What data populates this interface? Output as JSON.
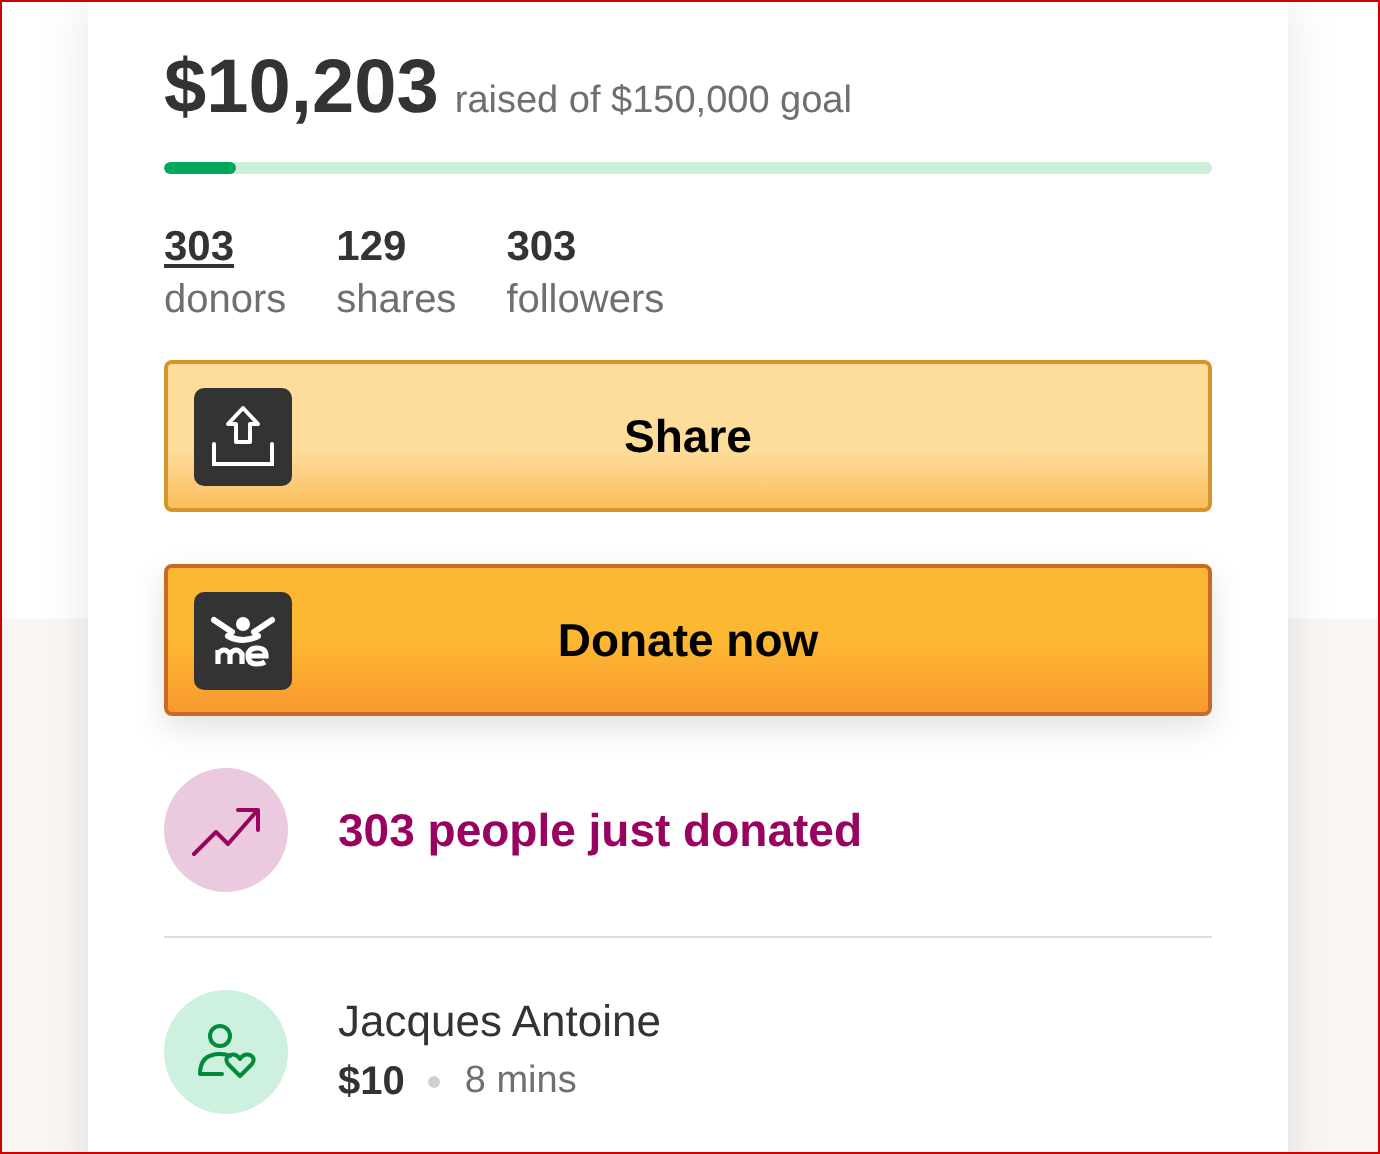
{
  "amount": {
    "raised": "$10,203",
    "goal_text": "raised of $150,000 goal"
  },
  "progress": {
    "level": 0.068
  },
  "stats": [
    {
      "value": "303",
      "label": "donors",
      "kind": "link"
    },
    {
      "value": "129",
      "label": "shares",
      "kind": "plain"
    },
    {
      "value": "303",
      "label": "followers",
      "kind": "plain"
    }
  ],
  "buttons": [
    {
      "label": "Share",
      "kind": "share"
    },
    {
      "label": "Donate now",
      "kind": "donate"
    }
  ],
  "activity": {
    "text": "303 people just donated"
  },
  "donations": [
    {
      "name": "Jacques Antoine",
      "amount": "$10",
      "time": "8 mins"
    }
  ]
}
